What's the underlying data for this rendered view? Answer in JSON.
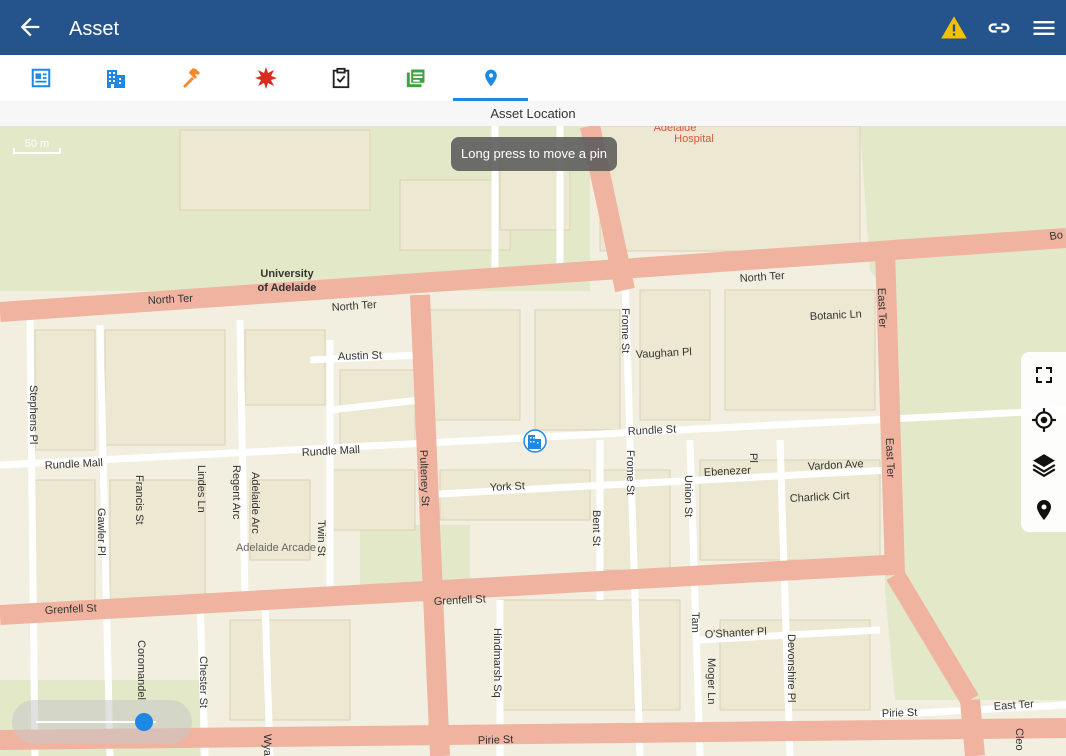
{
  "appbar": {
    "title": "Asset",
    "back_icon": "arrow-left-icon",
    "actions": [
      {
        "name": "warning-icon",
        "color": "#f2c200"
      },
      {
        "name": "link-icon"
      },
      {
        "name": "menu-icon"
      }
    ]
  },
  "tabs": [
    {
      "name": "details-icon",
      "color": "#1e88e5"
    },
    {
      "name": "building-icon",
      "color": "#1e88e5"
    },
    {
      "name": "hammer-icon",
      "color": "#f08a2a"
    },
    {
      "name": "damage-icon",
      "color": "#d62d20"
    },
    {
      "name": "clipboard-icon",
      "color": "#222222"
    },
    {
      "name": "notes-icon",
      "color": "#43a047"
    },
    {
      "name": "location-pin-icon",
      "color": "#1e88e5",
      "active": true
    }
  ],
  "subtitle": "Asset Location",
  "map": {
    "toast": "Long press to move a pin",
    "scale": "50 m",
    "labels": {
      "hospital": "Adelaide Hospital",
      "hospital_line1": "Adelaide",
      "hospital_line2": "Hospital",
      "univ_line1": "University",
      "univ_line2": "of Adelaide",
      "north_ter_1": "North Ter",
      "north_ter_2": "North Ter",
      "north_ter_3": "North Ter",
      "bo": "Bo",
      "stephens_pl": "Stephens Pl",
      "austin_st": "Austin St",
      "frome_st_1": "Frome St",
      "frome_st_2": "Frome St",
      "vaughan_pl": "Vaughan Pl",
      "botanic_ln": "Botanic Ln",
      "east_ter_1": "East Ter",
      "east_ter_2": "East Ter",
      "east_ter_3": "East Ter",
      "rundle_mall_1": "Rundle Mall",
      "rundle_mall_2": "Rundle Mall",
      "rundle_st": "Rundle St",
      "ebenezer": "Ebenezer",
      "ebenezer_pl": "Pl",
      "vardon_ave": "Vardon Ave",
      "york_st": "York St",
      "charlick_cirt": "Charlick Cirt",
      "francis_st": "Francis St",
      "lindes_ln": "Lindes Ln",
      "regent_arc": "Regent Arc",
      "adelaide_arc": "Adelaide Arc",
      "adelaide_arcade": "Adelaide Arcade",
      "twin_st": "Twin St",
      "pulteney_st": "Pulteney St",
      "gawler_pl": "Gawler Pl",
      "bent_st": "Bent St",
      "union_st": "Union St",
      "grenfell_st_1": "Grenfell St",
      "grenfell_st_2": "Grenfell St",
      "hindmarsh_sq": "Hindmarsh Sq",
      "tam": "Tam",
      "oshanter_pl": "O'Shanter Pl",
      "devonshire_pl": "Devonshire Pl",
      "moger_ln": "Moger Ln",
      "coromandel": "Coromandel",
      "chester_st": "Chester St",
      "wya": "Wya",
      "pirie_st_1": "Pirie St",
      "pirie_st_2": "Pirie St",
      "cleo": "Cleo"
    },
    "colors": {
      "land": "#f2efe0",
      "block": "#ece8d1",
      "park": "#e3e8c8",
      "major_road": "#efb3a0",
      "minor_road": "#ffffff"
    }
  },
  "tools": [
    {
      "name": "fullscreen-icon"
    },
    {
      "name": "locate-me-icon"
    },
    {
      "name": "layers-icon"
    },
    {
      "name": "place-pin-icon"
    }
  ],
  "slider": {
    "value": 0.9
  }
}
